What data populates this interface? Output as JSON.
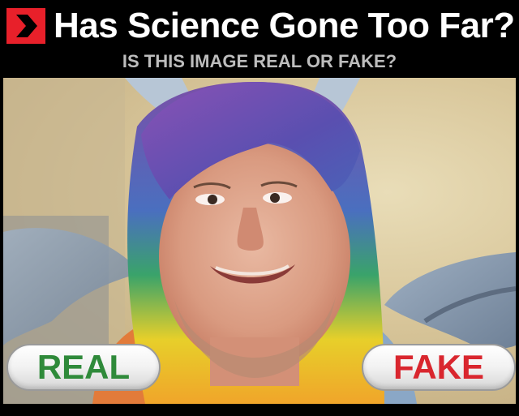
{
  "header": {
    "title": "Has Science Gone Too Far?",
    "subtitle": "IS THIS IMAGE REAL OR FAKE?",
    "accent_color": "#e8202a",
    "icon": "chevron-right-icon"
  },
  "buttons": {
    "real_label": "REAL",
    "fake_label": "FAKE",
    "real_color": "#2f8a3a",
    "fake_color": "#d9262e"
  }
}
